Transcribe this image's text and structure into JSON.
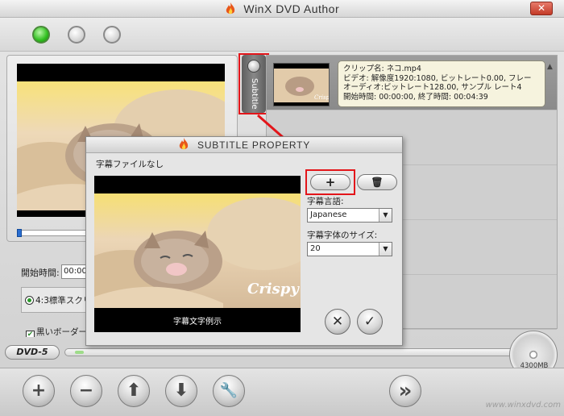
{
  "app": {
    "title": "WinX DVD Author",
    "close_label": "✕"
  },
  "left": {
    "start_time_label": "開始時間:",
    "start_time_value": "00:00:",
    "aspect_option": "4:3標準スクリ",
    "black_border_label": "黒いボーダー"
  },
  "subtitle_tab": {
    "label": "Subtitle"
  },
  "clip": {
    "thumb_text": "Crispy",
    "lines": [
      "クリップ名:  ネコ.mp4",
      "ビデオ:  解像度1920:1080, ビットレート0.00, フレー",
      "オーディオ:ビットレート128.00, サンプル  レート4",
      "開始時間:  00:00:00, 終了時間:  00:04:39"
    ]
  },
  "dialog": {
    "title": "SUBTITLE PROPERTY",
    "no_subtitle_file": "字幕ファイルなし",
    "add_label": "+",
    "delete_label": "🗑",
    "language_label": "字幕言語:",
    "language_value": "Japanese",
    "font_size_label": "字幕字体のサイズ:",
    "font_size_value": "20",
    "preview_overlay_text": "Crispy",
    "preview_caption": "字幕文字例示",
    "cancel_label": "✕",
    "ok_label": "✓"
  },
  "capacity": {
    "dvd_badge": "DVD-5",
    "disc_size": "4300MB",
    "used_fraction": 0.02
  },
  "bottom": {
    "add": "+",
    "remove": "−",
    "up": "⬆",
    "down": "⬇",
    "settings": "🔧",
    "next": "»",
    "watermark": "www.winxdvd.com"
  },
  "colors": {
    "highlight_red": "#e3151a",
    "green_led": "#2fbf1e"
  }
}
